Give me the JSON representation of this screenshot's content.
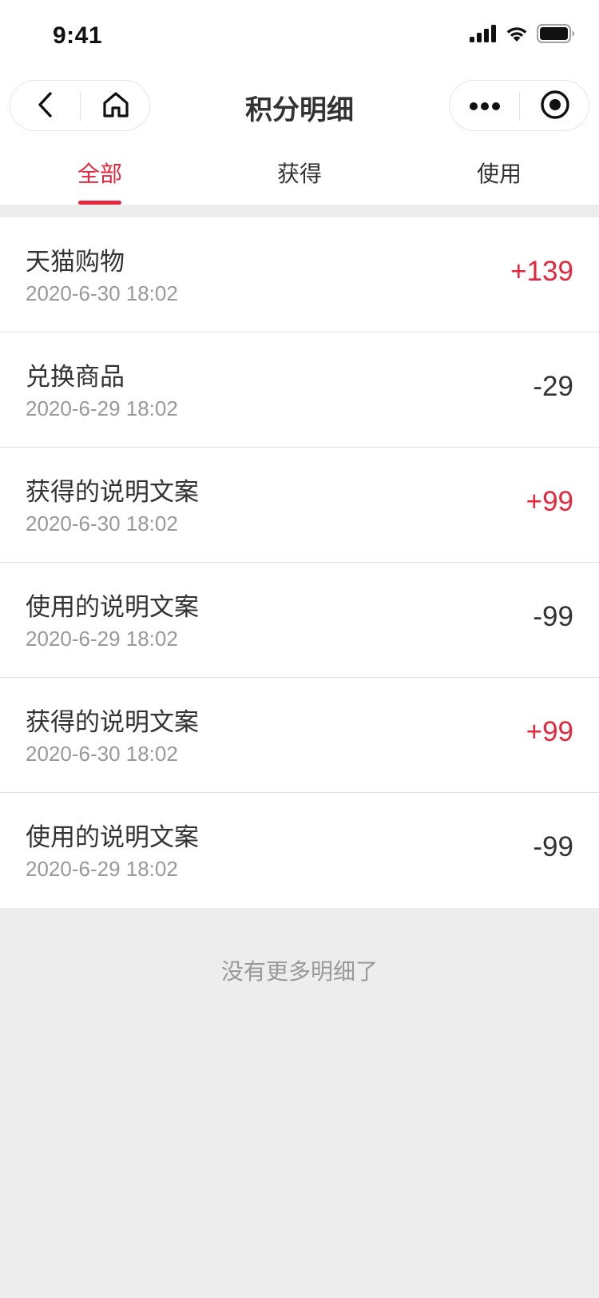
{
  "status_bar": {
    "time": "9:41"
  },
  "nav": {
    "title": "积分明细"
  },
  "tabs": [
    {
      "label": "全部",
      "active": true
    },
    {
      "label": "获得",
      "active": false
    },
    {
      "label": "使用",
      "active": false
    }
  ],
  "records": [
    {
      "title": "天猫购物",
      "date": "2020-6-30 18:02",
      "amount": "+139",
      "type": "plus"
    },
    {
      "title": "兑换商品",
      "date": "2020-6-29 18:02",
      "amount": "-29",
      "type": "minus"
    },
    {
      "title": "获得的说明文案",
      "date": "2020-6-30 18:02",
      "amount": "+99",
      "type": "plus"
    },
    {
      "title": "使用的说明文案",
      "date": "2020-6-29 18:02",
      "amount": "-99",
      "type": "minus"
    },
    {
      "title": "获得的说明文案",
      "date": "2020-6-30 18:02",
      "amount": "+99",
      "type": "plus"
    },
    {
      "title": "使用的说明文案",
      "date": "2020-6-29 18:02",
      "amount": "-99",
      "type": "minus"
    }
  ],
  "footer": {
    "text": "没有更多明细了"
  },
  "colors": {
    "accent": "#e5263c",
    "text": "#333333",
    "muted": "#999999",
    "background": "#ededed"
  },
  "icons": [
    "signal-icon",
    "wifi-icon",
    "battery-icon",
    "back-icon",
    "home-icon",
    "more-icon",
    "close-target-icon"
  ]
}
